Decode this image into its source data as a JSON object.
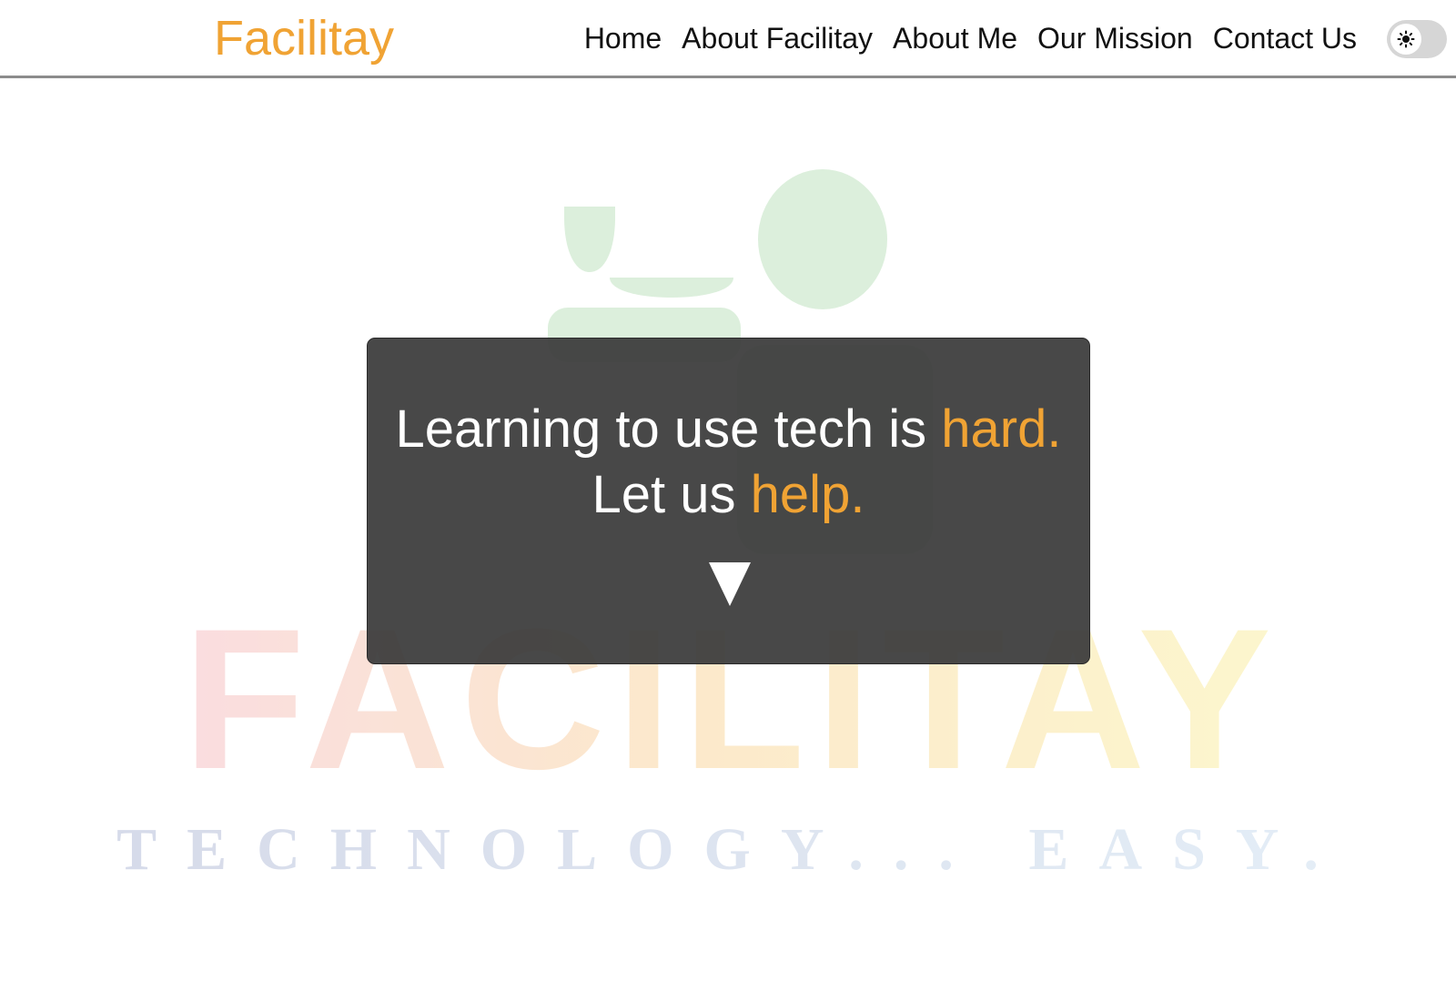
{
  "brand": {
    "name": "Facilitay",
    "color": "#f0a334"
  },
  "nav": {
    "items": [
      {
        "label": "Home"
      },
      {
        "label": "About Facilitay"
      },
      {
        "label": "About Me"
      },
      {
        "label": "Our Mission"
      },
      {
        "label": "Contact Us"
      }
    ],
    "theme_toggle": {
      "icon": "sun-icon",
      "state": "light"
    }
  },
  "hero": {
    "line1_text": "Learning to use tech is ",
    "line1_accent": "hard.",
    "line2_text": "Let us ",
    "line2_accent": "help.",
    "scroll_icon": "triangle-down-icon",
    "background_logo": {
      "wordmark": "FACILITAY",
      "tagline": "TECHNOLOGY... EASY."
    }
  }
}
